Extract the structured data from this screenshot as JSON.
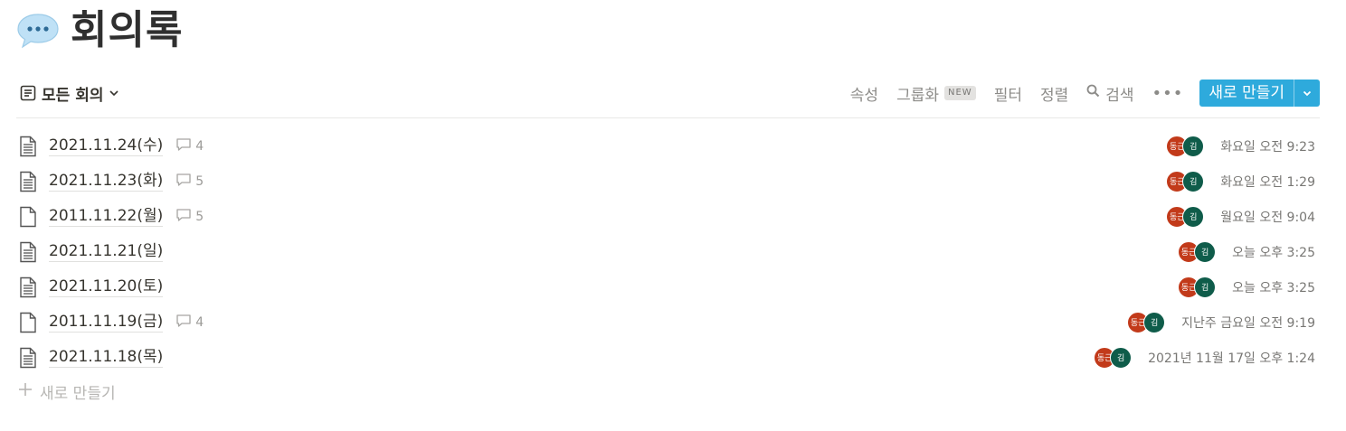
{
  "page": {
    "title": "회의록",
    "title_icon": "speech-balloon-icon"
  },
  "view": {
    "name": "모든 회의",
    "toolbar": {
      "properties": "속성",
      "group": "그룹화",
      "group_badge": "NEW",
      "filter": "필터",
      "sort": "정렬",
      "search": "검색",
      "more": "•••",
      "new_button": "새로 만들기"
    }
  },
  "colors": {
    "accent": "#2eaadc",
    "avatar_1": "#c23a1a",
    "avatar_2": "#0f5c4a"
  },
  "rows": [
    {
      "title": "2021.11.24(수)",
      "comments": "4",
      "avatar_1": "동근",
      "avatar_2": "김",
      "edited": "화요일 오전 9:23",
      "icon": "page-with-text-icon"
    },
    {
      "title": "2021.11.23(화)",
      "comments": "5",
      "avatar_1": "동근",
      "avatar_2": "김",
      "edited": "화요일 오전 1:29",
      "icon": "page-with-text-icon"
    },
    {
      "title": "2011.11.22(월)",
      "comments": "5",
      "avatar_1": "동근",
      "avatar_2": "김",
      "edited": "월요일 오전 9:04",
      "icon": "empty-page-icon"
    },
    {
      "title": "2021.11.21(일)",
      "comments": "",
      "avatar_1": "동근",
      "avatar_2": "김",
      "edited": "오늘 오후 3:25",
      "icon": "page-with-text-icon"
    },
    {
      "title": "2021.11.20(토)",
      "comments": "",
      "avatar_1": "동근",
      "avatar_2": "김",
      "edited": "오늘 오후 3:25",
      "icon": "page-with-text-icon"
    },
    {
      "title": "2011.11.19(금)",
      "comments": "4",
      "avatar_1": "동근",
      "avatar_2": "김",
      "edited": "지난주 금요일 오전 9:19",
      "icon": "empty-page-icon"
    },
    {
      "title": "2021.11.18(목)",
      "comments": "",
      "avatar_1": "동근",
      "avatar_2": "김",
      "edited": "2021년 11월 17일 오후 1:24",
      "icon": "page-with-text-icon"
    }
  ],
  "add_row_label": "새로 만들기"
}
